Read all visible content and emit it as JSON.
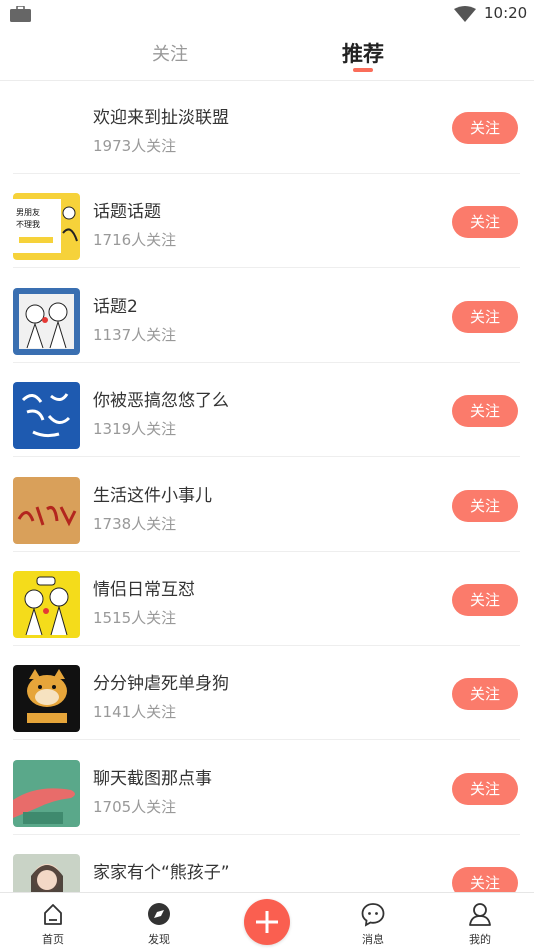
{
  "status_bar": {
    "time": "10:20"
  },
  "tabs": [
    {
      "label": "关注",
      "active": false
    },
    {
      "label": "推荐",
      "active": true
    }
  ],
  "colors": {
    "accent": "#fb7b6b",
    "plus": "#fa5f50"
  },
  "topics": [
    {
      "title": "欢迎来到扯淡联盟",
      "count": "1973人关注",
      "button": "关注",
      "thumb": "none"
    },
    {
      "title": "话题话题",
      "count": "1716人关注",
      "button": "关注",
      "thumb": "comic-yellow"
    },
    {
      "title": "话题2",
      "count": "1137人关注",
      "button": "关注",
      "thumb": "comic-blue"
    },
    {
      "title": "你被恶搞忽悠了么",
      "count": "1319人关注",
      "button": "关注",
      "thumb": "calligraphy-blue"
    },
    {
      "title": "生活这件小事儿",
      "count": "1738人关注",
      "button": "关注",
      "thumb": "calligraphy-tan"
    },
    {
      "title": "情侣日常互怼",
      "count": "1515人关注",
      "button": "关注",
      "thumb": "comic-couple-yellow"
    },
    {
      "title": "分分钟虐死单身狗",
      "count": "1141人关注",
      "button": "关注",
      "thumb": "doge-black"
    },
    {
      "title": "聊天截图那点事",
      "count": "1705人关注",
      "button": "关注",
      "thumb": "hand-green"
    },
    {
      "title": "家家有个“熊孩子”",
      "count": "",
      "button": "关注",
      "thumb": "photo-girl"
    }
  ],
  "bottom_nav": [
    {
      "label": "首页",
      "icon": "home-icon"
    },
    {
      "label": "发现",
      "icon": "discover-icon"
    },
    {
      "label": "",
      "icon": "plus-icon"
    },
    {
      "label": "消息",
      "icon": "message-icon"
    },
    {
      "label": "我的",
      "icon": "profile-icon"
    }
  ]
}
